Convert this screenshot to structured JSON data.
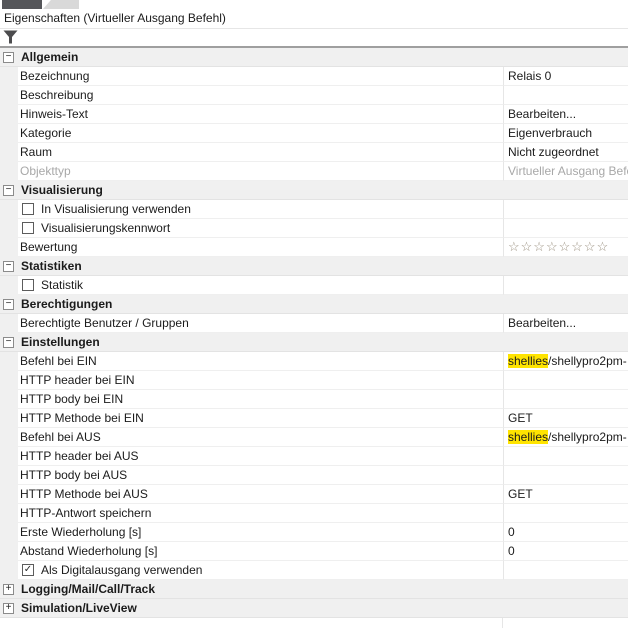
{
  "header": {
    "title": "Eigenschaften (Virtueller Ausgang Befehl)"
  },
  "icons": {
    "filter": "funnel",
    "collapse": "minus-box",
    "expand": "plus-box"
  },
  "colors": {
    "highlight": "#ffe400",
    "section_bg": "#f0f0f0",
    "star": "#9d9383",
    "muted_text": "#a8a8a8"
  },
  "sections": [
    {
      "label": "Allgemein",
      "state": "expanded",
      "rows": [
        {
          "type": "text",
          "label": "Bezeichnung",
          "value": "Relais 0"
        },
        {
          "type": "text",
          "label": "Beschreibung",
          "value": ""
        },
        {
          "type": "text",
          "label": "Hinweis-Text",
          "value": "Bearbeiten..."
        },
        {
          "type": "text",
          "label": "Kategorie",
          "value": "Eigenverbrauch"
        },
        {
          "type": "text",
          "label": "Raum",
          "value": "Nicht zugeordnet"
        },
        {
          "type": "text",
          "label": "Objekttyp",
          "value": "Virtueller Ausgang Befehl",
          "muted": true
        }
      ]
    },
    {
      "label": "Visualisierung",
      "state": "expanded",
      "rows": [
        {
          "type": "checkbox",
          "label": "In Visualisierung verwenden",
          "checked": false
        },
        {
          "type": "checkbox",
          "label": "Visualisierungskennwort",
          "checked": false
        },
        {
          "type": "stars",
          "label": "Bewertung",
          "stars_total": 8,
          "stars_filled": 0
        }
      ]
    },
    {
      "label": "Statistiken",
      "state": "expanded",
      "rows": [
        {
          "type": "checkbox",
          "label": "Statistik",
          "checked": false
        }
      ]
    },
    {
      "label": "Berechtigungen",
      "state": "expanded",
      "rows": [
        {
          "type": "text",
          "label": "Berechtigte Benutzer / Gruppen",
          "value": "Bearbeiten..."
        }
      ]
    },
    {
      "label": "Einstellungen",
      "state": "expanded",
      "rows": [
        {
          "type": "text",
          "label": "Befehl bei EIN",
          "value_highlight": "shellies",
          "value": "/shellypro2pm-"
        },
        {
          "type": "text",
          "label": "HTTP header bei EIN",
          "value": ""
        },
        {
          "type": "text",
          "label": "HTTP body bei EIN",
          "value": ""
        },
        {
          "type": "text",
          "label": "HTTP Methode bei EIN",
          "value": "GET"
        },
        {
          "type": "text",
          "label": "Befehl bei AUS",
          "value_highlight": "shellies",
          "value": "/shellypro2pm-"
        },
        {
          "type": "text",
          "label": "HTTP header bei AUS",
          "value": ""
        },
        {
          "type": "text",
          "label": "HTTP body bei AUS",
          "value": ""
        },
        {
          "type": "text",
          "label": "HTTP Methode bei AUS",
          "value": "GET"
        },
        {
          "type": "text",
          "label": "HTTP-Antwort speichern",
          "value": ""
        },
        {
          "type": "text",
          "label": "Erste Wiederholung [s]",
          "value": "0"
        },
        {
          "type": "text",
          "label": "Abstand Wiederholung [s]",
          "value": "0"
        },
        {
          "type": "checkbox",
          "label": "Als Digitalausgang verwenden",
          "checked": true
        }
      ]
    },
    {
      "label": "Logging/Mail/Call/Track",
      "state": "collapsed",
      "rows": []
    },
    {
      "label": "Simulation/LiveView",
      "state": "collapsed",
      "rows": []
    }
  ]
}
